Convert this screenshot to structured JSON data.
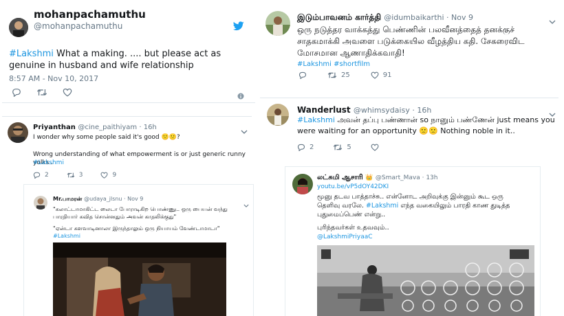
{
  "colors": {
    "link": "#1b95e0",
    "muted": "#657786",
    "twitter_blue": "#1da1f2",
    "border": "#e1e8ed"
  },
  "tweet1": {
    "name": "mohanpachamuthu",
    "handle": "@mohanpachamuthu",
    "hashtag": "#Lakshmi",
    "text": " What a making. .... but please act as genuine in husband and wife relationship",
    "timestamp": "8:57 AM - Nov 10, 2017",
    "icons": [
      "twitter-bird-icon",
      "reply-icon",
      "retweet-icon",
      "like-icon",
      "info-icon"
    ]
  },
  "tweet2": {
    "name": "Priyanthan",
    "handle": "@cine_paithiyam · 16h",
    "line1": "I wonder why some people said it's good 🙁🙁?",
    "line2": "Wrong understanding of what empowerment is or just generic runny yolks..",
    "hashtag": "#Lakshmi",
    "counts": {
      "reply": "2",
      "retweet": "3",
      "like": "9"
    }
  },
  "tweet3": {
    "name": "Mr.பாமரன்",
    "handle": "@udaya_jlsnu · Nov 9",
    "line1": "\"கலாட்டாமாகிட்ட லைடா போராடிகிற பொண்ணு.. ஒரு பையன் வந்து",
    "line2": "பாரதியார் கவித சொன்னதும் அவன் காதலிக்குது\"",
    "line3": "\"ஏன்டா களவாடினாலா இருந்தாலும் ஒரு நியாயம் வேண்டாமாடா\"",
    "hashtag": "#Lakshmi"
  },
  "tweet4": {
    "name": "இடும்பாவனம் கார்த்தி",
    "handle": "@idumbaikarthi · Nov 9",
    "line1": "ஒரு நடுத்தர வாக்கத்து பெண்ணின் பலவீனத்தைத் தனக்குச்",
    "line2": "சாதகமாக்கி அவளை படுக்கையில வீழத்திய கதி. சேகரைவிட",
    "line3": "மோசமான ஆணாதிக்கவாதி!",
    "hashtags": "#Lakshmi #shortfilm",
    "counts": {
      "reply": "",
      "retweet": "25",
      "like": "91"
    }
  },
  "tweet5": {
    "name": "Wanderlust",
    "handle": "@whimsydaisy · 16h",
    "hashtag": "#Lakshmi",
    "line1": " அவன் தப்பு பண்ணான் so நானும் பண்ணேன் just means you",
    "line2": "were waiting for an opportunity 🙁🙁 Nothing noble in it..",
    "counts": {
      "reply": "2",
      "retweet": "5",
      "like": ""
    }
  },
  "tweet6": {
    "name": "லட்சுமி ஆசாரி",
    "handle": "@Smart_Mava · 13h",
    "link": "youtu.be/vP5dOY42DKI",
    "line1": "மூனு தடவ பாத்தாச்சு.. என்னோட அறிவுக்கு இன்னும் கூட ஒரு",
    "line2a": "தெளிவு வரலே. ",
    "hashtag": "#Lakshmi",
    "line2b": " எந்த வகையிலும் பாரதி காண துடித்த",
    "line3": "புதுமைப்பெண் என்று..",
    "line4": "புரிந்தவர்கள் உதவவும்..",
    "mention": "@LakshmiPriyaaC"
  }
}
